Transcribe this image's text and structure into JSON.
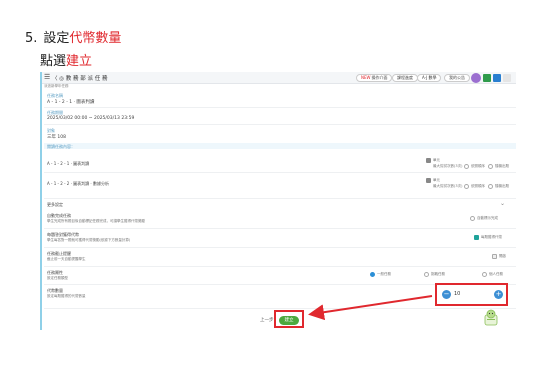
{
  "instructions": {
    "step_number": "5.",
    "step_prefix": "設定",
    "step_highlight": "代幣數量",
    "sub_prefix": "點選",
    "sub_highlight": "建立"
  },
  "app": {
    "breadcrumb": "〈 ◎ 教 務 部 派 任 務",
    "sub_crumb": "派遣新學年任務",
    "toolbar": {
      "new_badge": "NEW",
      "btn1": "操作介面",
      "btn2": "課程進度",
      "btn3": "A·J 數學",
      "btn4": "我的公告"
    }
  },
  "fields": {
    "task_name_label": "任務名稱",
    "task_name_value": "A - 1 - 2 - 1 · 圖表判讀",
    "task_period_label": "任務期間",
    "task_period_value": "2025/03/02 00:00 ~ 2025/03/13 23:59",
    "target_label": "對象",
    "target_value": "三年 108",
    "content_band": "閱讀任務內容："
  },
  "items": [
    {
      "title": "A - 1 - 2 - 1 · 圖表判讀",
      "check1": "單元",
      "check2": "最大嘗試次數(3次)",
      "opt1": "依照順序",
      "opt2": "隨機出題"
    },
    {
      "title": "A - 1 - 2 - 2 · 圖表判讀 · 數據分析",
      "check1": "單元",
      "check2": "最大嘗試次數(3次)",
      "opt1": "依照順序",
      "opt2": "隨機出題"
    }
  ],
  "settings": {
    "header": "更多設定",
    "s1_title": "自動完成任務",
    "s1_desc": "學生完成所有題目後自動標記任務完成，可讓學生獲得代幣獎勵",
    "s1_option": "自動標示完成",
    "s2_title": "每題答對獲得代幣",
    "s2_desc": "學生每答對一題就可獲得代幣獎勵(依據下方數量計算)",
    "s2_option": "每題獲得代幣",
    "s3_title": "任務截止提醒",
    "s3_desc": "截止前一天自動提醒學生",
    "s3_option": "開啟",
    "s4_title": "任務屬性",
    "s4_desc": "設定任務類型",
    "s4_opt1": "一般任務",
    "s4_opt2": "挑戰任務",
    "s4_opt3": "個人任務",
    "s5_title": "代幣數量",
    "s5_desc": "設定每題獲得的代幣數量"
  },
  "token_stepper": {
    "value": "10",
    "minus": "−",
    "plus": "+"
  },
  "footer": {
    "prev": "上一步",
    "create": "建立"
  },
  "colors": {
    "highlight_red": "#e0282e",
    "create_green": "#4ca93f",
    "stepper_blue": "#3d8fd4"
  }
}
